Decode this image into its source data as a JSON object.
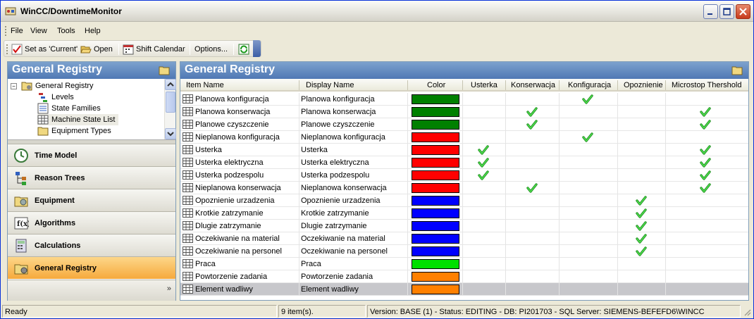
{
  "window": {
    "title": "WinCC/DowntimeMonitor"
  },
  "menu": [
    "File",
    "View",
    "Tools",
    "Help"
  ],
  "toolbar": {
    "set_current": "Set as 'Current'",
    "open": "Open",
    "shift_calendar": "Shift Calendar",
    "options": "Options..."
  },
  "left_pane": {
    "title": "General Registry",
    "tree": [
      {
        "label": "General Registry",
        "icon": "folder-icon"
      },
      {
        "label": "Levels",
        "icon": "levels-icon"
      },
      {
        "label": "State Families",
        "icon": "list-icon"
      },
      {
        "label": "Machine State List",
        "icon": "grid-icon"
      },
      {
        "label": "Equipment Types",
        "icon": "folder-icon"
      }
    ],
    "nav": [
      {
        "label": "Time Model",
        "icon": "clock-icon"
      },
      {
        "label": "Reason Trees",
        "icon": "tree-icon"
      },
      {
        "label": "Equipment",
        "icon": "equipment-icon"
      },
      {
        "label": "Algorithms",
        "icon": "function-icon"
      },
      {
        "label": "Calculations",
        "icon": "calculator-icon"
      },
      {
        "label": "General Registry",
        "icon": "registry-icon"
      }
    ],
    "nav_more": "»"
  },
  "right_pane": {
    "title": "General Registry",
    "columns": [
      "Item Name",
      "Display Name",
      "Color",
      "Usterka",
      "Konserwacja",
      "Konfiguracja",
      "Opoznienie",
      "Microstop Thershold"
    ],
    "rows": [
      {
        "item": "Planowa konfiguracja",
        "display": "Planowa konfiguracja",
        "color": "#008000",
        "flags": [
          false,
          false,
          true,
          false,
          false
        ]
      },
      {
        "item": "Planowa konserwacja",
        "display": "Planowa konserwacja",
        "color": "#008000",
        "flags": [
          false,
          true,
          false,
          false,
          true
        ]
      },
      {
        "item": "Planowe czyszczenie",
        "display": "Planowe czyszczenie",
        "color": "#008000",
        "flags": [
          false,
          true,
          false,
          false,
          true
        ]
      },
      {
        "item": "Nieplanowa konfiguracja",
        "display": "Nieplanowa konfiguracja",
        "color": "#ff0000",
        "flags": [
          false,
          false,
          true,
          false,
          false
        ]
      },
      {
        "item": "Usterka",
        "display": "Usterka",
        "color": "#ff0000",
        "flags": [
          true,
          false,
          false,
          false,
          true
        ]
      },
      {
        "item": "Usterka elektryczna",
        "display": "Usterka elektryczna",
        "color": "#ff0000",
        "flags": [
          true,
          false,
          false,
          false,
          true
        ]
      },
      {
        "item": "Usterka podzespolu",
        "display": "Usterka podzespolu",
        "color": "#ff0000",
        "flags": [
          true,
          false,
          false,
          false,
          true
        ]
      },
      {
        "item": "Nieplanowa konserwacja",
        "display": "Nieplanowa konserwacja",
        "color": "#ff0000",
        "flags": [
          false,
          true,
          false,
          false,
          true
        ]
      },
      {
        "item": "Opoznienie urzadzenia",
        "display": "Opoznienie urzadzenia",
        "color": "#0000ff",
        "flags": [
          false,
          false,
          false,
          true,
          false
        ]
      },
      {
        "item": "Krotkie zatrzymanie",
        "display": "Krotkie zatrzymanie",
        "color": "#0000ff",
        "flags": [
          false,
          false,
          false,
          true,
          false
        ]
      },
      {
        "item": "Dlugie zatrzymanie",
        "display": "Dlugie zatrzymanie",
        "color": "#0000ff",
        "flags": [
          false,
          false,
          false,
          true,
          false
        ]
      },
      {
        "item": "Oczekiwanie na material",
        "display": "Oczekiwanie na material",
        "color": "#0000ff",
        "flags": [
          false,
          false,
          false,
          true,
          false
        ]
      },
      {
        "item": "Oczekiwanie na personel",
        "display": "Oczekiwanie na personel",
        "color": "#0000ff",
        "flags": [
          false,
          false,
          false,
          true,
          false
        ]
      },
      {
        "item": "Praca",
        "display": "Praca",
        "color": "#00e000",
        "flags": [
          false,
          false,
          false,
          false,
          false
        ]
      },
      {
        "item": "Powtorzenie zadania",
        "display": "Powtorzenie zadania",
        "color": "#ff8000",
        "flags": [
          false,
          false,
          false,
          false,
          false
        ]
      },
      {
        "item": "Element wadliwy",
        "display": "Element wadliwy",
        "color": "#ff8000",
        "flags": [
          false,
          false,
          false,
          false,
          false
        ],
        "selected": true
      }
    ]
  },
  "statusbar": {
    "state": "Ready",
    "items": "9 item(s).",
    "info": "Version: BASE (1) - Status: EDITING - DB: PI201703 - SQL Server: SIEMENS-BEFEFD6\\WINCC"
  }
}
